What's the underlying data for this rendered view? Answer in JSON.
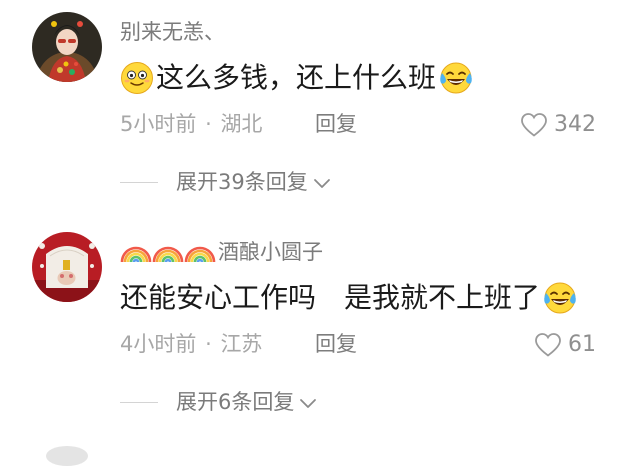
{
  "comments": [
    {
      "username": "别来无恙、",
      "content_text": "这么多钱，还上什么班",
      "leading_emoji": "grinning-sweat-emoji",
      "trailing_emoji": "tears-of-joy-emoji",
      "time": "5小时前",
      "separator": "·",
      "location": "湖北",
      "reply_label": "回复",
      "likes": "342",
      "expand_label": "展开39条回复"
    },
    {
      "username": "酒酿小圆子",
      "rainbow_count": 3,
      "content_text": "还能安心工作吗　是我就不上班了",
      "trailing_emoji": "tears-of-joy-emoji",
      "time": "4小时前",
      "separator": "·",
      "location": "江苏",
      "reply_label": "回复",
      "likes": "61",
      "expand_label": "展开6条回复"
    }
  ],
  "colors": {
    "username": "#7b7b7b",
    "content": "#1a1a1a",
    "meta": "#a7a7a7",
    "divider": "#d4d4d4"
  }
}
